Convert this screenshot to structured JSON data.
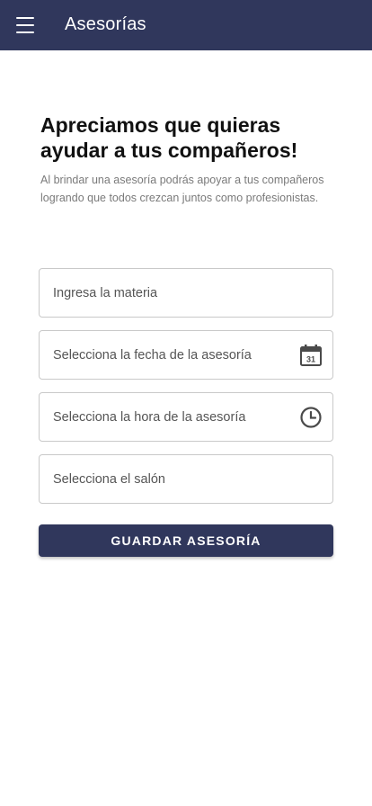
{
  "appbar": {
    "title": "Asesorías",
    "menu_icon": "menu-icon"
  },
  "intro": {
    "headline": "Apreciamos que quieras ayudar a tus compañeros!",
    "subtitle": "Al brindar una asesoría podrás apoyar a tus compañeros logrando que todos crezcan juntos como profesionistas."
  },
  "form": {
    "subject": {
      "placeholder": "Ingresa la materia",
      "value": ""
    },
    "date": {
      "placeholder": "Selecciona la fecha de la asesoría",
      "value": "",
      "icon": "calendar-icon",
      "icon_text": "31"
    },
    "time": {
      "placeholder": "Selecciona la hora de la asesoría",
      "value": "",
      "icon": "clock-icon"
    },
    "room": {
      "placeholder": "Selecciona el salón",
      "value": ""
    },
    "save_label": "GUARDAR ASESORÍA"
  },
  "colors": {
    "primary": "#30375c",
    "border": "#c9c9c9",
    "subtitle": "#7a7a7a"
  }
}
